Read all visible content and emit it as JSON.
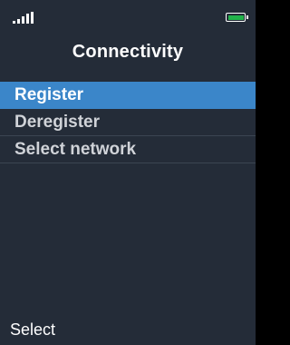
{
  "status": {
    "signal_icon": "signal-strength-icon",
    "battery_icon": "battery-icon",
    "battery_color": "#21b24a"
  },
  "screen": {
    "title": "Connectivity"
  },
  "menu": {
    "selected_index": 0,
    "items": [
      {
        "label": "Register"
      },
      {
        "label": "Deregister"
      },
      {
        "label": "Select network"
      }
    ]
  },
  "softkeys": {
    "left": "Select"
  },
  "colors": {
    "background": "#242c38",
    "highlight": "#3b86c9"
  }
}
